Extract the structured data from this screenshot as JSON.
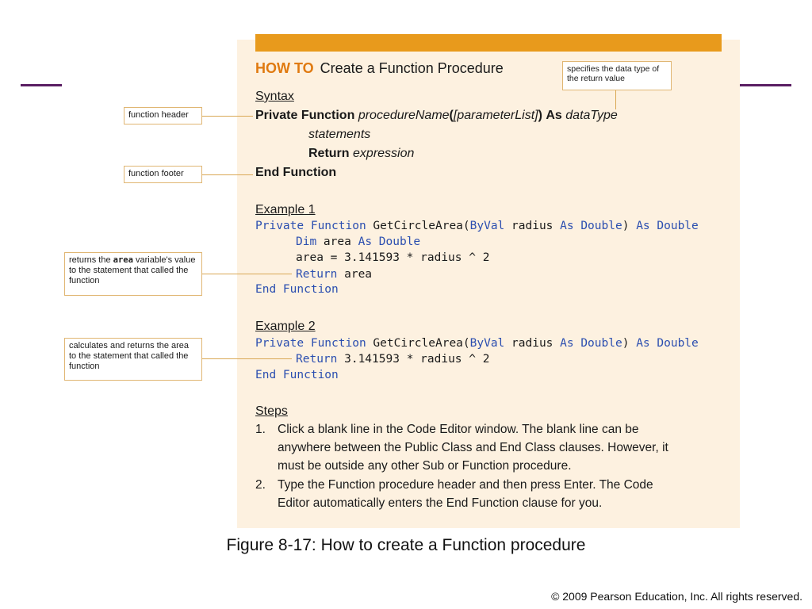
{
  "howto": {
    "prefix": "HOW TO",
    "title": "Create a Function Procedure"
  },
  "callouts": {
    "return_type": "specifies the data type of the return value",
    "header": "function header",
    "footer": "function footer",
    "ex1_pre": "returns the ",
    "ex1_code": "area",
    "ex1_post": " variable's value to the statement that called the function",
    "ex2": "calculates and returns the area to the statement that called the function"
  },
  "syntax": {
    "heading": "Syntax",
    "header_kw1": "Private Function",
    "header_name": "procedureName",
    "header_open": "(",
    "header_params": "[parameterList]",
    "header_close": ")",
    "header_as": "As",
    "header_type": "dataType",
    "statements": "statements",
    "return_kw": "Return",
    "return_expr": "expression",
    "footer": "End Function"
  },
  "example1": {
    "heading": "Example 1",
    "l1_kw1": "Private Function",
    "l1_name": " GetCircleArea(",
    "l1_kw2": "ByVal",
    "l1_mid": " radius ",
    "l1_kw3": "As Double",
    "l1_close": ") ",
    "l1_kw4": "As Double",
    "l2_kw1": "Dim",
    "l2_mid": " area ",
    "l2_kw2": "As Double",
    "l3": "area = 3.141593 * radius ^ 2",
    "l4_kw": "Return",
    "l4_rest": " area",
    "l5": "End Function"
  },
  "example2": {
    "heading": "Example 2",
    "l1_kw1": "Private Function",
    "l1_name": " GetCircleArea(",
    "l1_kw2": "ByVal",
    "l1_mid": " radius ",
    "l1_kw3": "As Double",
    "l1_close": ") ",
    "l1_kw4": "As Double",
    "l2_kw": "Return",
    "l2_rest": " 3.141593 * radius ^ 2",
    "l3": "End Function"
  },
  "steps": {
    "heading": "Steps",
    "s1_num": "1.",
    "s1_l1": "Click a blank line in the Code Editor window. The blank line can be",
    "s1_l2": "anywhere between the Public Class and End Class clauses. However, it",
    "s1_l3": "must be outside any other Sub or Function procedure.",
    "s2_num": "2.",
    "s2_l1": "Type the Function procedure header and then press Enter. The Code",
    "s2_l2": "Editor automatically enters the End Function clause for you."
  },
  "caption": "Figure 8-17: How to create a Function procedure",
  "copyright": "© 2009 Pearson Education, Inc.  All rights reserved.",
  "colors": {
    "accent_bar": "#e89a1c",
    "panel": "#fdf1e0",
    "keyword": "#2b4eb0",
    "rule": "#5a1e63"
  }
}
